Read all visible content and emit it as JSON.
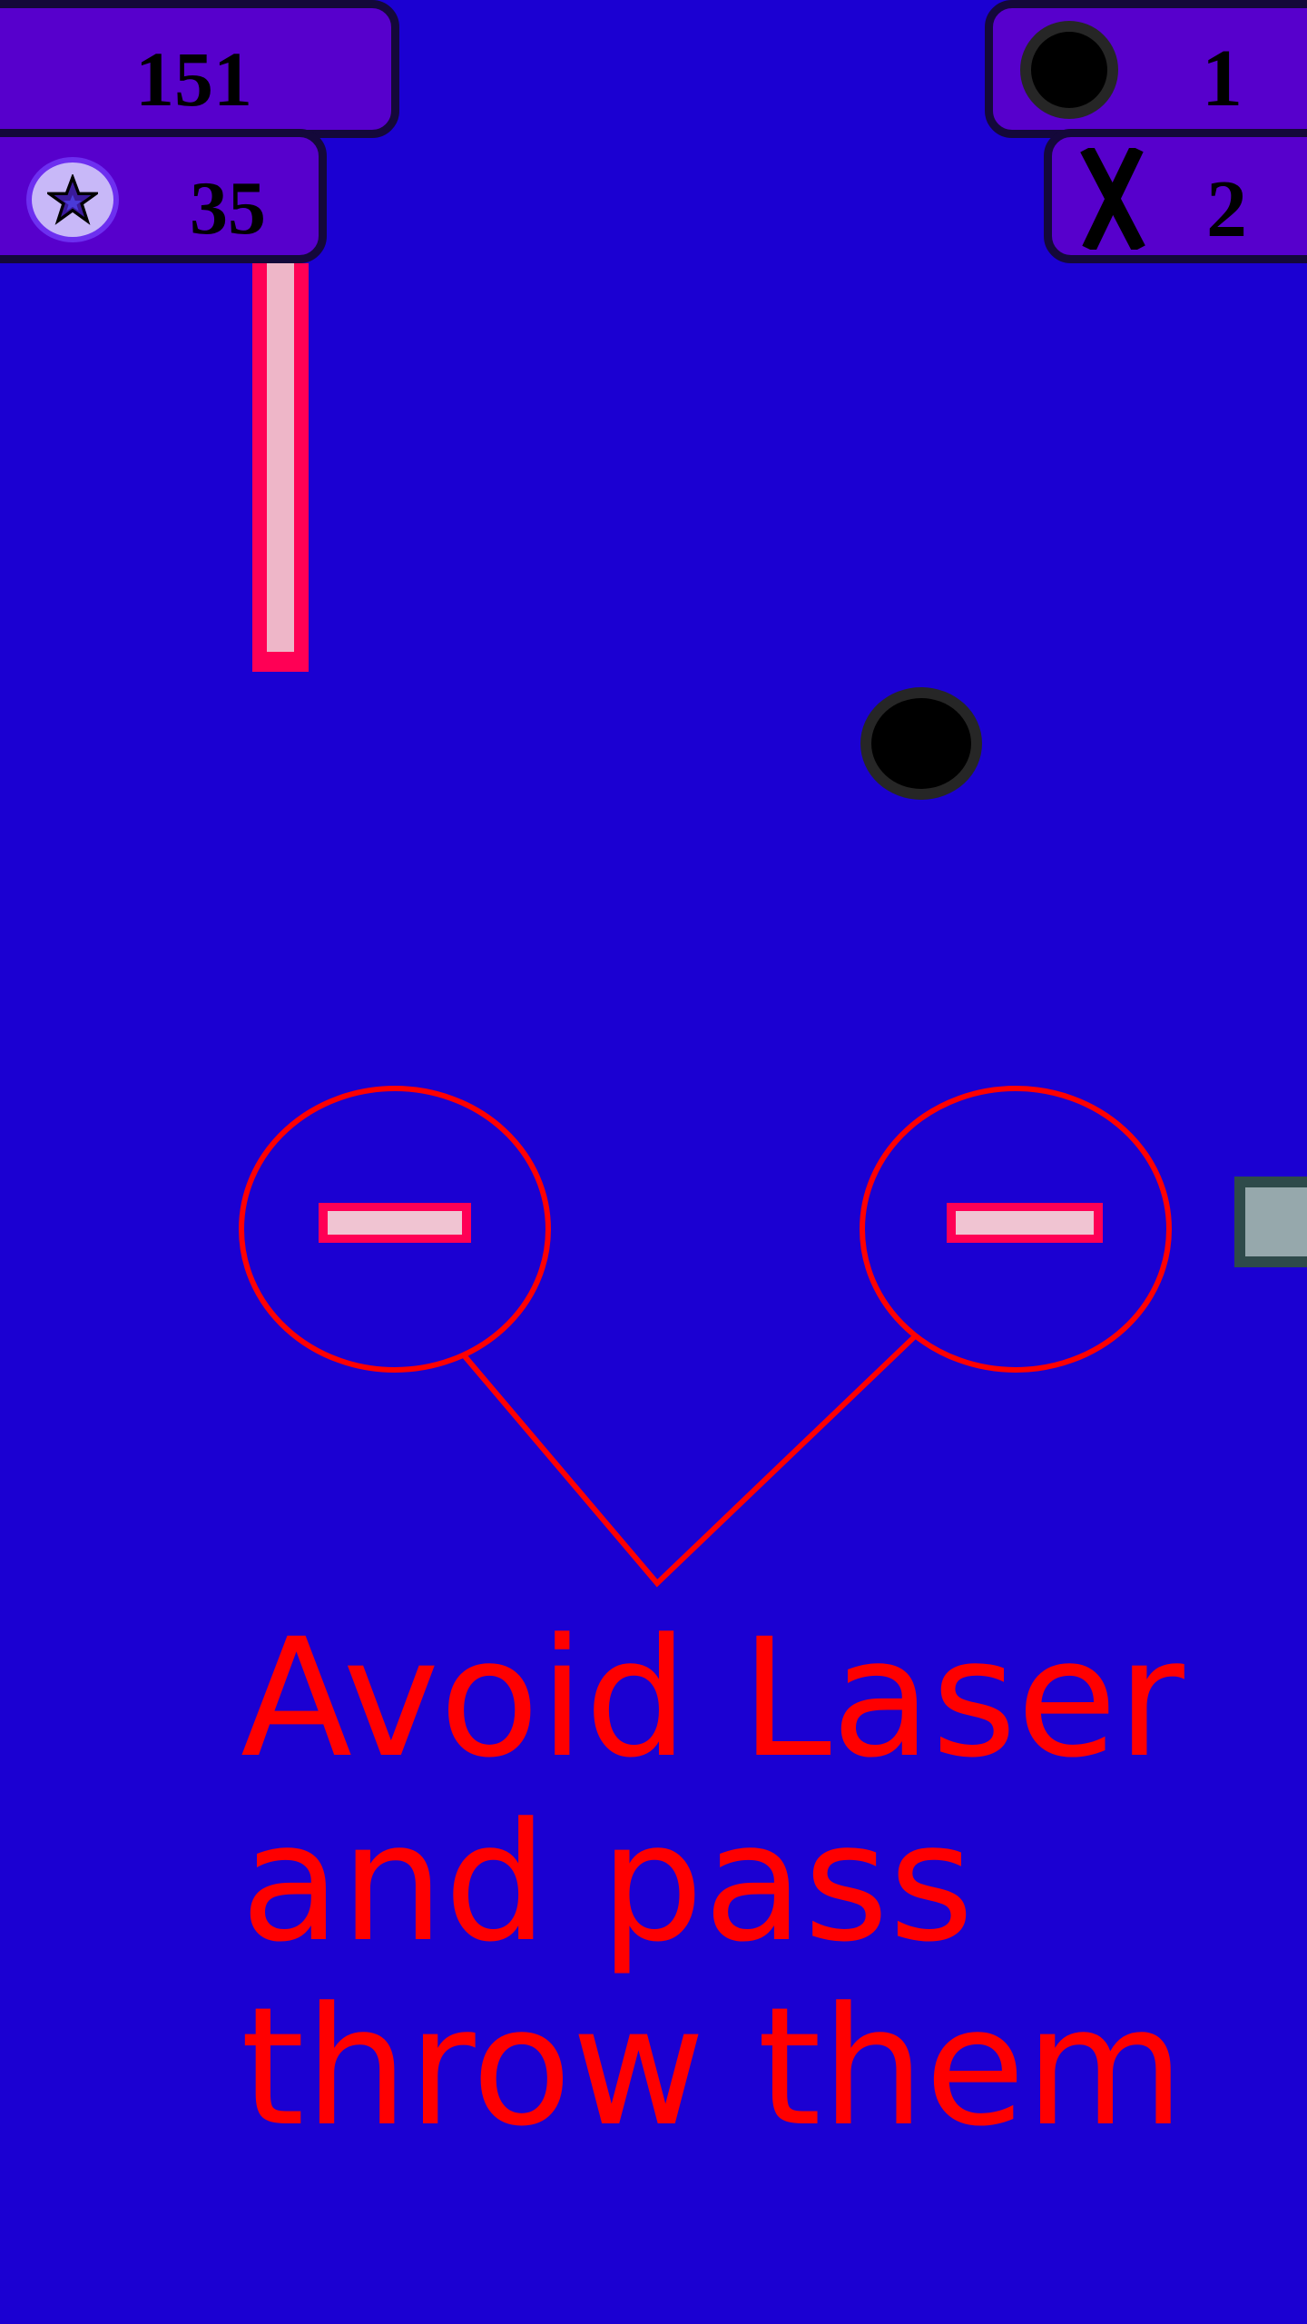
{
  "hud": {
    "score": "151",
    "stars": "35",
    "balls": "1",
    "lives": "2"
  },
  "tutorial": {
    "lines": [
      "Avoid Laser",
      "and pass",
      "throw them"
    ]
  },
  "icons": {
    "star": "star-icon",
    "ball": "ball-icon",
    "lives": "x-icon"
  },
  "colors": {
    "background": "#1b00d2",
    "hud_panel": "#5700cc",
    "laser": "#ff0055",
    "laser_core": "#eeb6c8",
    "tutorial_text": "#ff0000"
  }
}
